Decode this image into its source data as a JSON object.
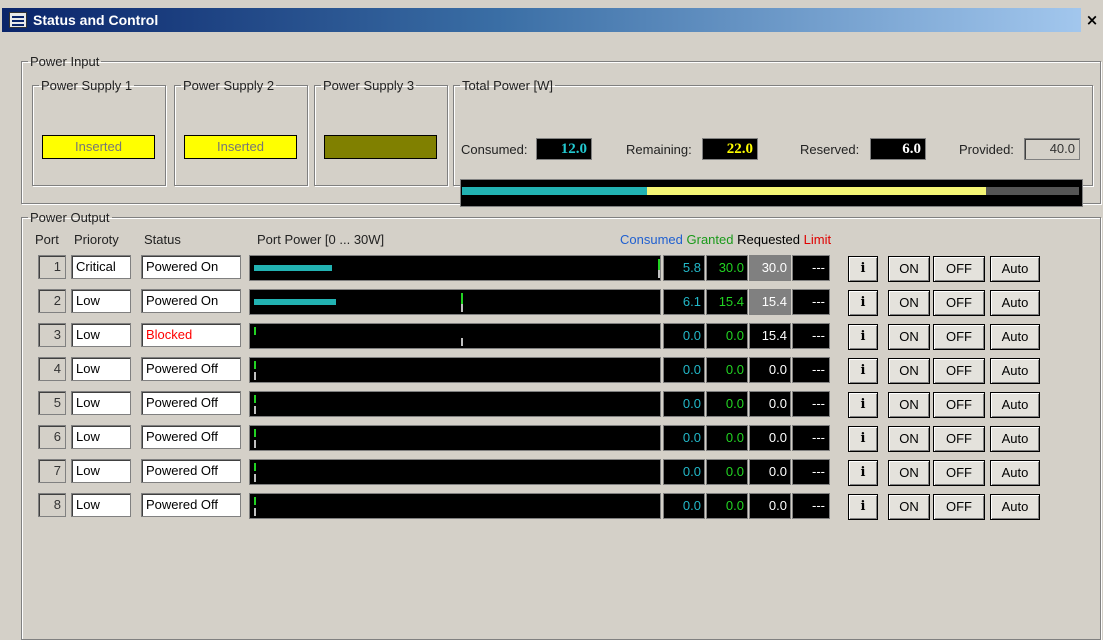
{
  "window": {
    "title": "Status and Control",
    "close_symbol": "×"
  },
  "power_input": {
    "legend": "Power Input",
    "supplies": [
      {
        "label": "Power Supply 1",
        "state": "Inserted",
        "color": "#ffff00"
      },
      {
        "label": "Power Supply 2",
        "state": "Inserted",
        "color": "#ffff00"
      },
      {
        "label": "Power Supply 3",
        "state": "",
        "color": "#808000"
      }
    ],
    "total": {
      "legend": "Total Power [W]",
      "consumed_label": "Consumed:",
      "consumed": "12.0",
      "consumed_color": "#22c8d0",
      "remaining_label": "Remaining:",
      "remaining": "22.0",
      "remaining_color": "#ffff00",
      "reserved_label": "Reserved:",
      "reserved": "6.0",
      "reserved_color": "#ffffff",
      "provided_label": "Provided:",
      "provided": "40.0",
      "bar_segments": [
        {
          "name": "consumed",
          "watts": 12.0,
          "color": "#22b2b2"
        },
        {
          "name": "remaining",
          "watts": 22.0,
          "color": "#f5f575"
        },
        {
          "name": "reserved",
          "watts": 6.0,
          "color": "#555555"
        }
      ],
      "bar_total_watts": 40.0
    }
  },
  "power_output": {
    "legend": "Power Output",
    "headers": {
      "port": "Port",
      "priority": "Prioroty",
      "status": "Status",
      "port_power": "Port Power [0 ... 30W]",
      "consumed": "Consumed",
      "granted": "Granted",
      "requested": "Requested",
      "limit": "Limit"
    },
    "header_colors": {
      "consumed": "#2060d0",
      "granted": "#1a9a1a",
      "requested": "#000000",
      "limit": "#e00000"
    },
    "max_watts": 30,
    "buttons": {
      "info": "i",
      "on": "ON",
      "off": "OFF",
      "auto": "Auto"
    },
    "ports": [
      {
        "port": "1",
        "priority": "Critical",
        "status": "Powered On",
        "status_color": "#000000",
        "consumed": "5.8",
        "granted": "30.0",
        "requested": "30.0",
        "requested_grey": true,
        "limit": "---",
        "consumed_w": 5.8,
        "granted_w": 30.0,
        "requested_w": 30.0
      },
      {
        "port": "2",
        "priority": "Low",
        "status": "Powered On",
        "status_color": "#000000",
        "consumed": "6.1",
        "granted": "15.4",
        "requested": "15.4",
        "requested_grey": true,
        "limit": "---",
        "consumed_w": 6.1,
        "granted_w": 15.4,
        "requested_w": 15.4
      },
      {
        "port": "3",
        "priority": "Low",
        "status": "Blocked",
        "status_color": "#ff0000",
        "consumed": "0.0",
        "granted": "0.0",
        "requested": "15.4",
        "requested_grey": false,
        "limit": "---",
        "consumed_w": 0.0,
        "granted_w": 0.0,
        "requested_w": 15.4
      },
      {
        "port": "4",
        "priority": "Low",
        "status": "Powered Off",
        "status_color": "#000000",
        "consumed": "0.0",
        "granted": "0.0",
        "requested": "0.0",
        "requested_grey": false,
        "limit": "---",
        "consumed_w": 0.0,
        "granted_w": 0.0,
        "requested_w": 0.0
      },
      {
        "port": "5",
        "priority": "Low",
        "status": "Powered Off",
        "status_color": "#000000",
        "consumed": "0.0",
        "granted": "0.0",
        "requested": "0.0",
        "requested_grey": false,
        "limit": "---",
        "consumed_w": 0.0,
        "granted_w": 0.0,
        "requested_w": 0.0
      },
      {
        "port": "6",
        "priority": "Low",
        "status": "Powered Off",
        "status_color": "#000000",
        "consumed": "0.0",
        "granted": "0.0",
        "requested": "0.0",
        "requested_grey": false,
        "limit": "---",
        "consumed_w": 0.0,
        "granted_w": 0.0,
        "requested_w": 0.0
      },
      {
        "port": "7",
        "priority": "Low",
        "status": "Powered Off",
        "status_color": "#000000",
        "consumed": "0.0",
        "granted": "0.0",
        "requested": "0.0",
        "requested_grey": false,
        "limit": "---",
        "consumed_w": 0.0,
        "granted_w": 0.0,
        "requested_w": 0.0
      },
      {
        "port": "8",
        "priority": "Low",
        "status": "Powered Off",
        "status_color": "#000000",
        "consumed": "0.0",
        "granted": "0.0",
        "requested": "0.0",
        "requested_grey": false,
        "limit": "---",
        "consumed_w": 0.0,
        "granted_w": 0.0,
        "requested_w": 0.0
      }
    ]
  }
}
